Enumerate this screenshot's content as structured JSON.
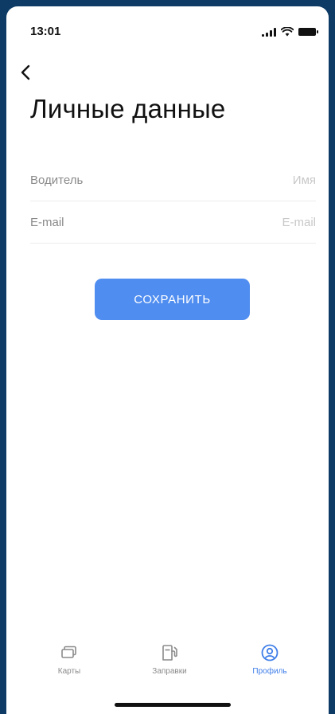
{
  "status_bar": {
    "time": "13:01"
  },
  "header": {
    "back_icon": "chevron-left-icon",
    "title": "Личные данные"
  },
  "form": {
    "driver": {
      "label": "Водитель",
      "value": "",
      "placeholder": "Имя"
    },
    "email": {
      "label": "E-mail",
      "value": "",
      "placeholder": "E-mail"
    },
    "save_label": "СОХРАНИТЬ"
  },
  "tab_bar": {
    "active": "profile",
    "active_color": "#3f7ee8",
    "inactive_color": "#8a8a8a",
    "items": [
      {
        "id": "cards",
        "label": "Карты",
        "icon": "cards-icon"
      },
      {
        "id": "fuel",
        "label": "Заправки",
        "icon": "fuel-station-icon"
      },
      {
        "id": "profile",
        "label": "Профиль",
        "icon": "user-circle-icon"
      }
    ]
  },
  "colors": {
    "accent": "#4f8df0",
    "frame": "#0d3b66",
    "divider": "#ececec"
  }
}
